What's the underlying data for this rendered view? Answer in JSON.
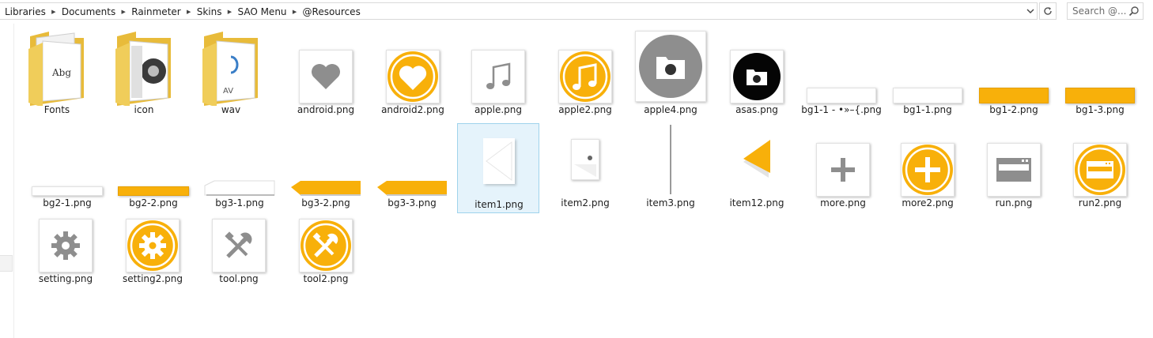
{
  "breadcrumb": [
    "Libraries",
    "Documents",
    "Rainmeter",
    "Skins",
    "SAO Menu",
    "@Resources"
  ],
  "search": {
    "placeholder": "Search @..."
  },
  "colors": {
    "accent": "#f8b00a",
    "gray": "#8e8e8e",
    "selection": "#e5f3fb"
  },
  "items": [
    {
      "label": "Fonts",
      "kind": "folder",
      "icon": "folder-fonts-icon"
    },
    {
      "label": "icon",
      "kind": "folder",
      "icon": "folder-icon-icon"
    },
    {
      "label": "wav",
      "kind": "folder",
      "icon": "folder-wav-icon"
    },
    {
      "label": "android.png",
      "kind": "image",
      "icon": "heart-gray-icon"
    },
    {
      "label": "android2.png",
      "kind": "image",
      "icon": "heart-orange-icon"
    },
    {
      "label": "apple.png",
      "kind": "image",
      "icon": "music-note-gray-icon"
    },
    {
      "label": "apple2.png",
      "kind": "image",
      "icon": "music-note-orange-icon"
    },
    {
      "label": "apple4.png",
      "kind": "image",
      "icon": "folder-circle-gray-icon"
    },
    {
      "label": "asas.png",
      "kind": "image",
      "icon": "folder-circle-black-icon"
    },
    {
      "label": "bg1-1 - •»–{.png",
      "kind": "image",
      "icon": "white-bar-icon"
    },
    {
      "label": "bg1-1.png",
      "kind": "image",
      "icon": "white-bar-icon"
    },
    {
      "label": "bg1-2.png",
      "kind": "image",
      "icon": "orange-bar-icon"
    },
    {
      "label": "bg1-3.png",
      "kind": "image",
      "icon": "orange-bar-icon"
    },
    {
      "label": "bg2-1.png",
      "kind": "image",
      "icon": "white-thin-bar-icon"
    },
    {
      "label": "bg2-2.png",
      "kind": "image",
      "icon": "orange-thin-bar-icon"
    },
    {
      "label": "bg3-1.png",
      "kind": "image",
      "icon": "white-arrow-bar-icon"
    },
    {
      "label": "bg3-2.png",
      "kind": "image",
      "icon": "orange-arrow-bar-icon"
    },
    {
      "label": "bg3-3.png",
      "kind": "image",
      "icon": "orange-arrow-bar-icon"
    },
    {
      "label": "item1.png",
      "kind": "image",
      "icon": "white-triangle-icon",
      "selected": true
    },
    {
      "label": "item2.png",
      "kind": "image",
      "icon": "small-card-icon"
    },
    {
      "label": "item3.png",
      "kind": "image",
      "icon": "vertical-line-icon"
    },
    {
      "label": "item12.png",
      "kind": "image",
      "icon": "orange-triangle-icon"
    },
    {
      "label": "more.png",
      "kind": "image",
      "icon": "plus-gray-icon"
    },
    {
      "label": "more2.png",
      "kind": "image",
      "icon": "plus-orange-icon"
    },
    {
      "label": "run.png",
      "kind": "image",
      "icon": "window-gray-icon"
    },
    {
      "label": "run2.png",
      "kind": "image",
      "icon": "window-orange-icon"
    },
    {
      "label": "setting.png",
      "kind": "image",
      "icon": "gear-gray-icon"
    },
    {
      "label": "setting2.png",
      "kind": "image",
      "icon": "gear-orange-icon"
    },
    {
      "label": "tool.png",
      "kind": "image",
      "icon": "tools-gray-icon"
    },
    {
      "label": "tool2.png",
      "kind": "image",
      "icon": "tools-orange-icon"
    }
  ]
}
